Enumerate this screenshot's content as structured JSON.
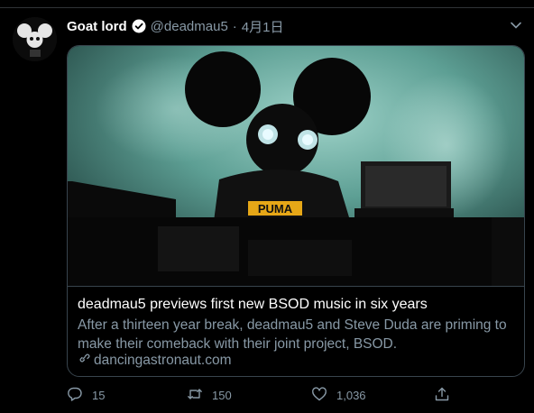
{
  "tweet": {
    "display_name": "Goat lord",
    "handle": "@deadmau5",
    "separator": "·",
    "date": "4月1日"
  },
  "card": {
    "title": "deadmau5 previews first new BSOD music in six years",
    "description": "After a thirteen year break, deadmau5 and Steve Duda are priming to make their comeback with their joint project, BSOD.",
    "domain": "dancingastronaut.com",
    "image_shirt_text": "PUMA"
  },
  "actions": {
    "replies": "15",
    "retweets": "150",
    "likes": "1,036"
  },
  "icons": [
    "verified-badge-icon",
    "caret-down-icon",
    "link-icon",
    "reply-icon",
    "retweet-icon",
    "like-icon",
    "share-icon"
  ],
  "colors": {
    "background": "#000000",
    "secondary_text": "#8899a6",
    "border": "#38444d"
  }
}
